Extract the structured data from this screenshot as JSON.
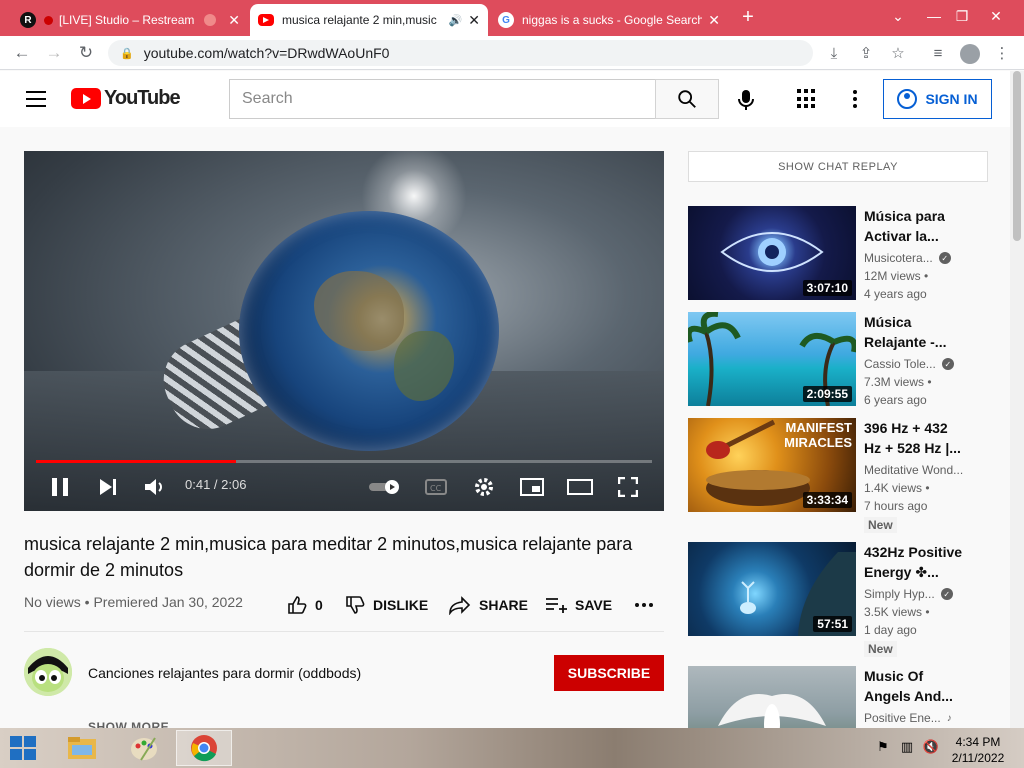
{
  "browser": {
    "tabs": [
      {
        "title": "[LIVE] Studio – Restream",
        "favicon": "R"
      },
      {
        "title": "musica relajante 2 min,music",
        "favicon": "yt"
      },
      {
        "title": "niggas is a sucks - Google Search",
        "favicon": "G"
      }
    ],
    "url": "youtube.com/watch?v=DRwdWAoUnF0"
  },
  "masthead": {
    "logo_text": "YouTube",
    "search_placeholder": "Search",
    "sign_in": "SIGN IN"
  },
  "player": {
    "time": "0:41 / 2:06",
    "progress_fraction": 0.325
  },
  "video": {
    "title": "musica relajante 2 min,musica para meditar 2 minutos,musica relajante para dormir de 2 minutos",
    "meta": "No views • Premiered Jan 30, 2022",
    "likes": "0",
    "dislike": "DISLIKE",
    "share": "SHARE",
    "save": "SAVE",
    "channel": "Canciones relajantes para dormir (oddbods)",
    "subscribe": "SUBSCRIBE",
    "show_more": "SHOW MORE"
  },
  "sidebar": {
    "chat_replay": "SHOW CHAT REPLAY",
    "recs": [
      {
        "title": "Música para Activar la...",
        "channel": "Musicotera...",
        "views": "12M views •",
        "age": "4 years ago",
        "duration": "3:07:10",
        "verified": true,
        "badge": ""
      },
      {
        "title": "Música Relajante -...",
        "channel": "Cassio Tole...",
        "views": "7.3M views •",
        "age": "6 years ago",
        "duration": "2:09:55",
        "verified": true,
        "badge": ""
      },
      {
        "title": "396 Hz + 432 Hz + 528 Hz |...",
        "channel": "Meditative Wond...",
        "views": "1.4K views •",
        "age": "7 hours ago",
        "duration": "3:33:34",
        "verified": false,
        "badge": "New",
        "thumb_text": "MANIFEST MIRACLES"
      },
      {
        "title": "432Hz Positive Energy ✤...",
        "channel": "Simply Hyp...",
        "views": "3.5K views •",
        "age": "1 day ago",
        "duration": "57:51",
        "verified": true,
        "badge": "New"
      },
      {
        "title": "Music Of Angels And...",
        "channel": "Positive Ene...",
        "views": "",
        "age": "",
        "duration": "",
        "verified": false,
        "badge": ""
      }
    ]
  },
  "taskbar": {
    "time": "4:34 PM",
    "date": "2/11/2022"
  },
  "colors": {
    "tabstrip": "#de4c5c",
    "yt_red": "#ff0000",
    "subscribe": "#cc0000",
    "sign_in_blue": "#065fd4"
  }
}
